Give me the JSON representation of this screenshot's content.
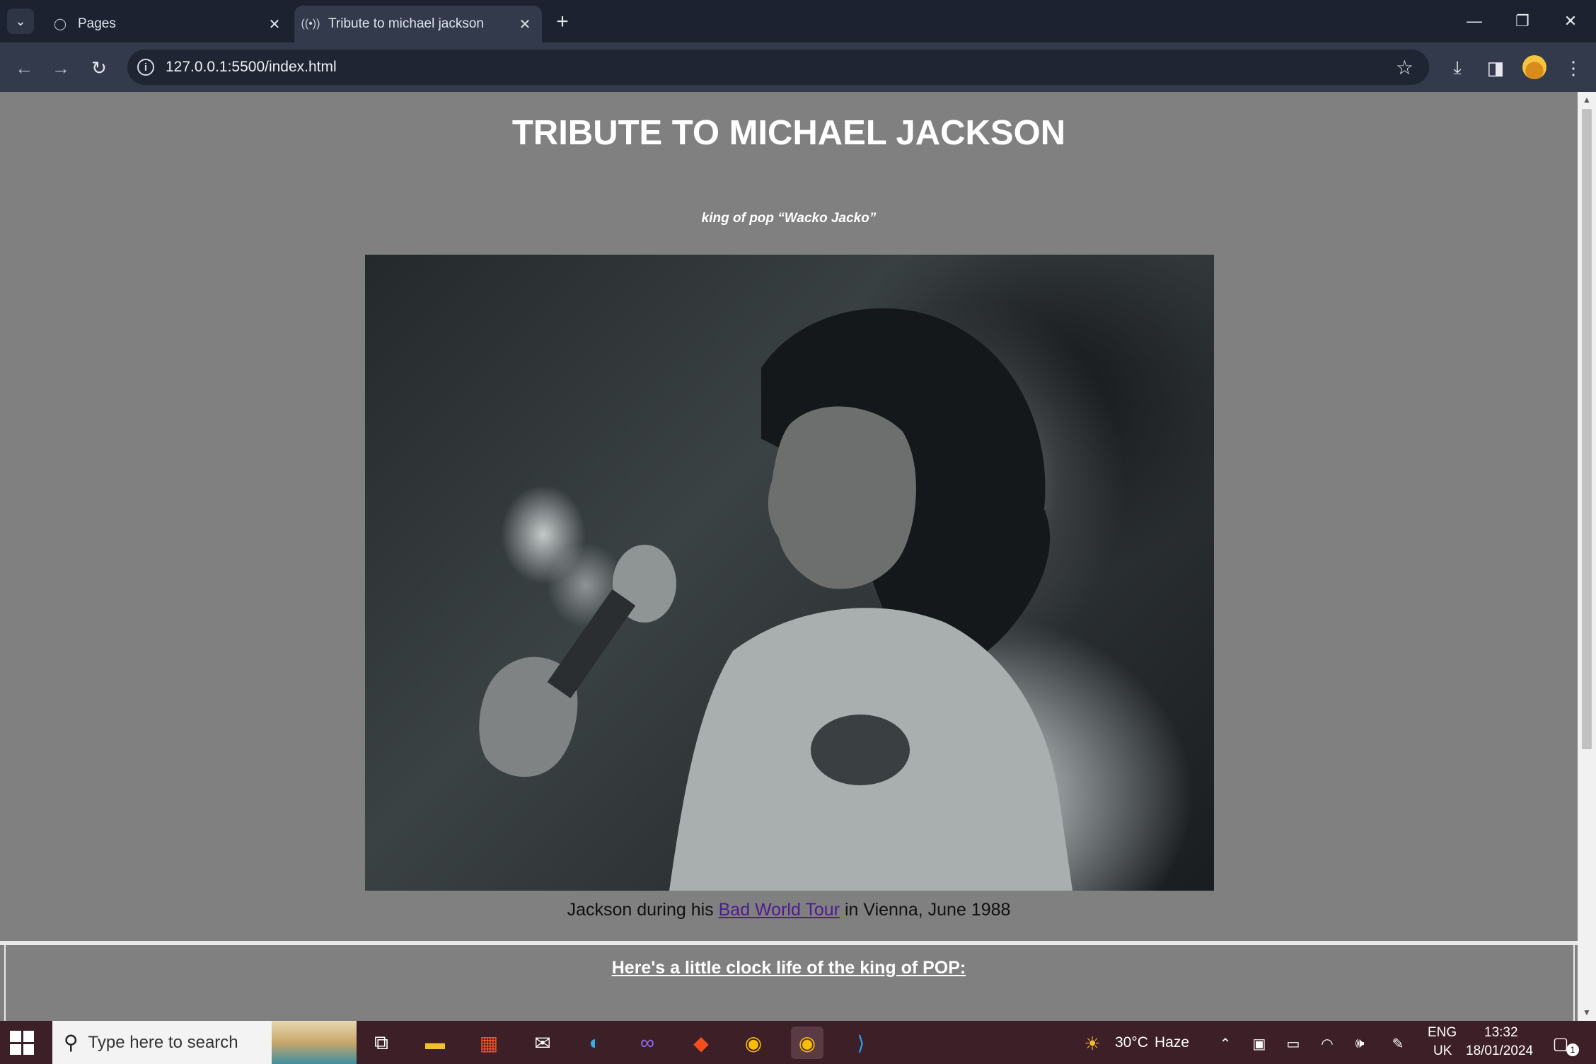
{
  "browser": {
    "tabs": [
      {
        "title": "Pages",
        "favicon": "github-icon",
        "active": false
      },
      {
        "title": "Tribute to michael jackson",
        "favicon": "live-server-icon",
        "active": true
      }
    ],
    "url": "127.0.0.1:5500/index.html"
  },
  "page": {
    "title": "TRIBUTE TO MICHAEL JACKSON",
    "subtitle": "king of pop “Wacko Jacko”",
    "caption_prefix": "Jackson during his ",
    "caption_link": "Bad World Tour",
    "caption_suffix": " in Vienna, June 1988",
    "section_heading": "Here's a little clock life of the king of POP:"
  },
  "taskbar": {
    "search_placeholder": "Type here to search",
    "weather": "30°C",
    "weather_condition": "Haze",
    "language": "ENG",
    "region": "UK",
    "time": "13:32",
    "date": "18/01/2024",
    "notification_count": "1"
  },
  "colors": {
    "page_background": "#808080",
    "link_color": "#4c1d8f",
    "browser_chrome": "#1c2230",
    "taskbar": "#3c1f27"
  }
}
